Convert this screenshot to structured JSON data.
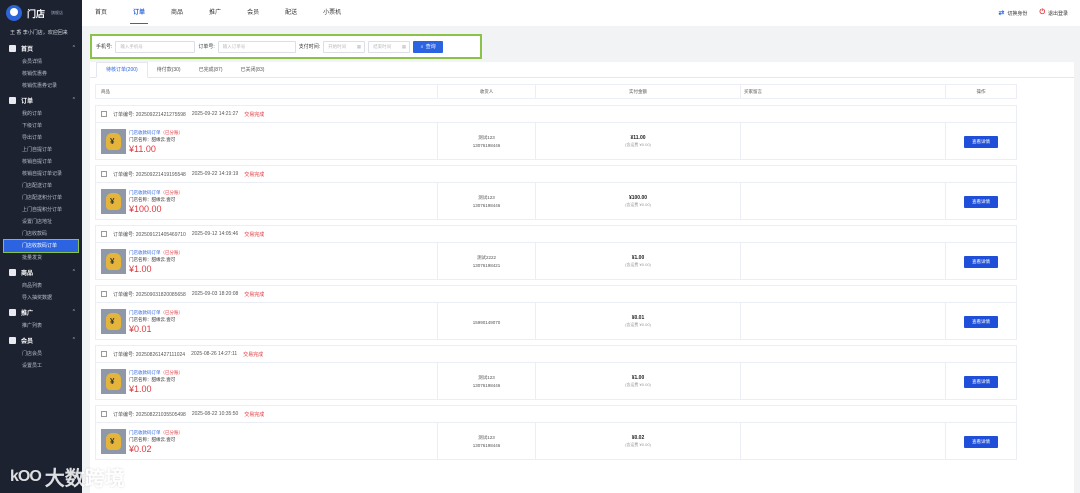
{
  "app": {
    "logo_text": "门店",
    "logo_sub": "旗舰店",
    "welcome": "王 香 李小门店，欢迎回来"
  },
  "sidebar": [
    {
      "label": "首页",
      "items": [
        "会员详情",
        "核销优惠券",
        "核销优惠券记录"
      ]
    },
    {
      "label": "订单",
      "items": [
        "我的订单",
        "下级订单",
        "导出订单",
        "上门自提订单",
        "核销自提订单",
        "核销自提订单记录",
        "门店配送订单",
        "门店配送积分订单",
        "上门自提积分订单",
        "设置门店地址",
        "门店收款码",
        "门店收款码订单",
        "批量发货"
      ],
      "active": "门店收款码订单"
    },
    {
      "label": "商品",
      "items": [
        "商品列表",
        "导入抽奖数据"
      ]
    },
    {
      "label": "推广",
      "items": [
        "推广列表"
      ]
    },
    {
      "label": "会员",
      "items": [
        "门店会员",
        "设置员工"
      ]
    }
  ],
  "topnav": {
    "tabs": [
      "首页",
      "订单",
      "商品",
      "推广",
      "会员",
      "配送",
      "小票机"
    ],
    "active": "订单",
    "switch_label": "切换身份",
    "logout_label": "退出登录"
  },
  "search": {
    "phone_label": "手机号:",
    "phone_placeholder": "输入手机号",
    "order_label": "订单号:",
    "order_placeholder": "输入订单号",
    "time_label": "支付时间:",
    "start_placeholder": "开始时间",
    "end_placeholder": "结束时间",
    "button": "查询"
  },
  "tabs": [
    "待核订单(200)",
    "待付款(30)",
    "已完成(87)",
    "已关闭(83)"
  ],
  "table": {
    "headers": [
      "商品",
      "收货人",
      "实付金额",
      "买家留言",
      "操作"
    ]
  },
  "orders": [
    {
      "no": "订单编号: 2025092214212755​98",
      "time": "2025-09-22 14:21:27",
      "status": "交易完成",
      "goods": "门店收款码订单",
      "tag": "（已分账）",
      "store": "门店名称：甜缘云.壹可",
      "price": "¥11.00",
      "buyer": "测试123",
      "phone": "13076198446",
      "amount": "¥11.00",
      "sub": "(含运费 ¥0.00)",
      "op": "查看详情"
    },
    {
      "no": "订单编号: 2025092214191955​48",
      "time": "2025-09-22 14:19:19",
      "status": "交易完成",
      "goods": "门店收款码订单",
      "tag": "（已分账）",
      "store": "门店名称：甜缘云.壹可",
      "price": "¥100.00",
      "buyer": "测试123",
      "phone": "13076198446",
      "amount": "¥100.00",
      "sub": "(含运费 ¥0.00)",
      "op": "查看详情"
    },
    {
      "no": "订单编号: 2025091214054697​10",
      "time": "2025-09-12 14:05:46",
      "status": "交易完成",
      "goods": "门店收款码订单",
      "tag": "（已分账）",
      "store": "门店名称：甜缘云.壹可",
      "price": "¥1.00",
      "buyer": "测试2222",
      "phone": "13076198421",
      "amount": "¥1.00",
      "sub": "(含运费 ¥0.00)",
      "op": "查看详情"
    },
    {
      "no": "订单编号: 2025090318200856​58",
      "time": "2025-09-03 18:20:08",
      "status": "交易完成",
      "goods": "门店收款码订单",
      "tag": "（已分账）",
      "store": "门店名称：甜缘云.壹可",
      "price": "¥0.01",
      "buyer": "",
      "phone": "15990149070",
      "amount": "¥0.01",
      "sub": "(含运费 ¥0.00)",
      "op": "查看详情"
    },
    {
      "no": "订单编号: 2025082614271110​24",
      "time": "2025-08-26 14:27:11",
      "status": "交易完成",
      "goods": "门店收款码订单",
      "tag": "（已分账）",
      "store": "门店名称：甜缘云.壹可",
      "price": "¥1.00",
      "buyer": "测试123",
      "phone": "13076198446",
      "amount": "¥1.00",
      "sub": "(含运费 ¥0.00)",
      "op": "查看详情"
    },
    {
      "no": "订单编号: 2025082210355054​98",
      "time": "2025-08-22 10:35:50",
      "status": "交易完成",
      "goods": "门店收款码订单",
      "tag": "（已分账）",
      "store": "门店名称：甜缘云.壹可",
      "price": "¥0.02",
      "buyer": "测试123",
      "phone": "13076198446",
      "amount": "¥0.02",
      "sub": "(含运费 ¥0.00)",
      "op": "查看详情"
    }
  ],
  "watermark": {
    "logo": "kOO",
    "text": "大数跨境"
  }
}
